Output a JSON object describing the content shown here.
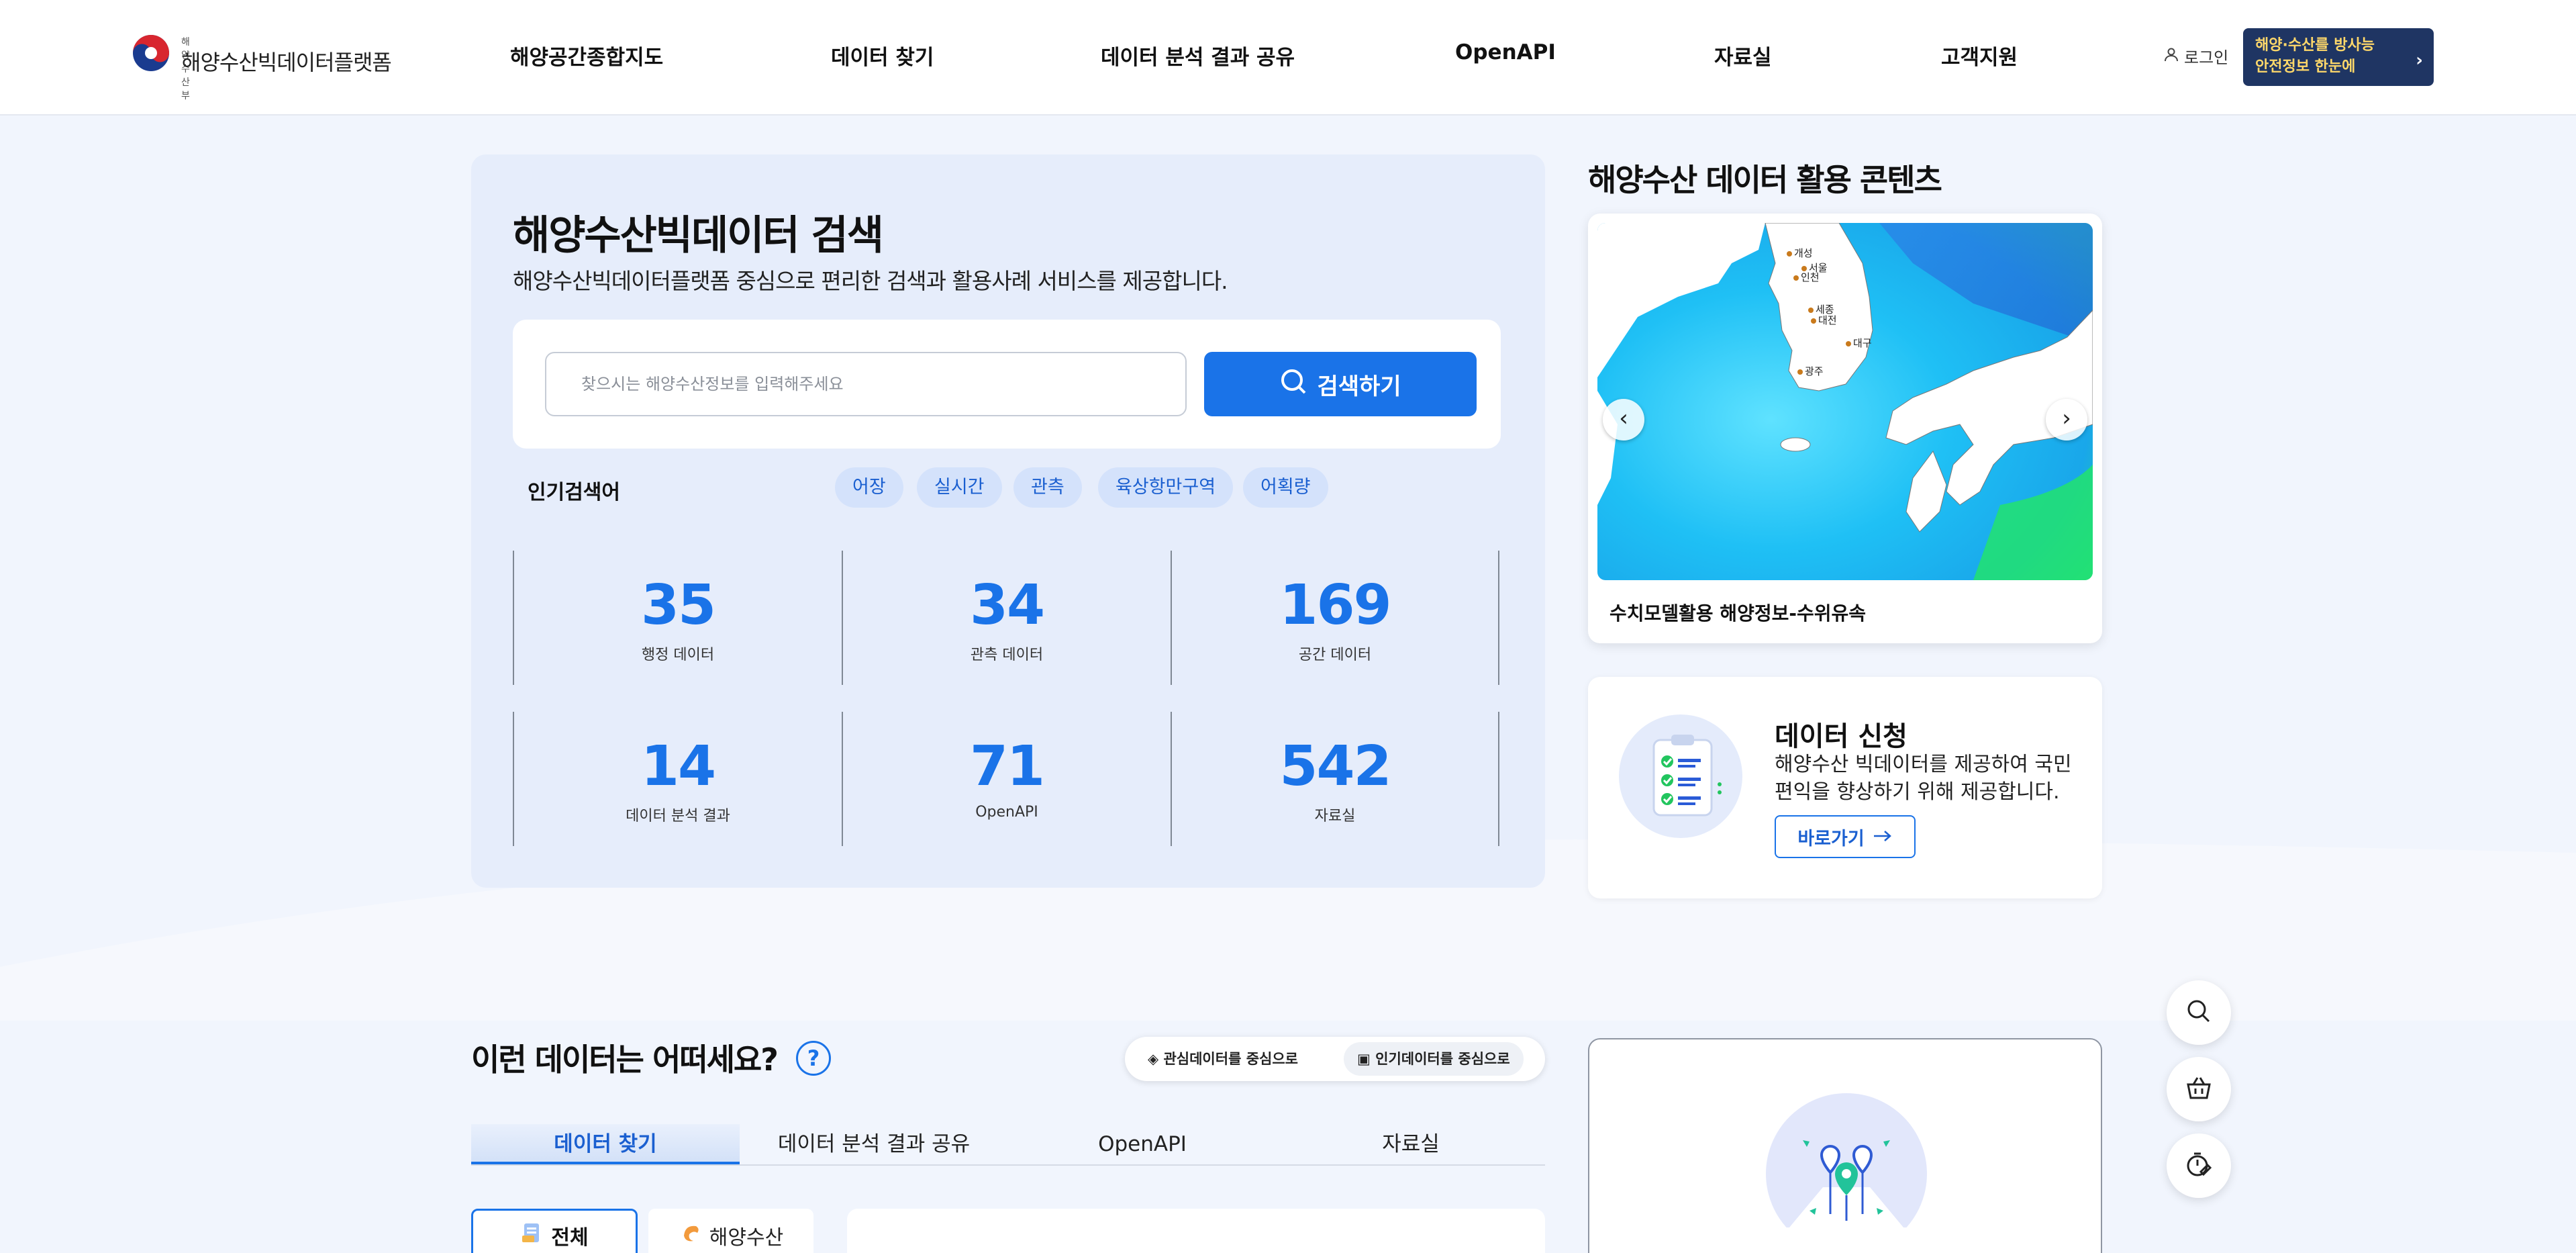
{
  "header": {
    "logo_sub": "해양수산부",
    "logo_text": "해양수산빅데이터플랫폼",
    "nav": [
      "해양공간종합지도",
      "데이터 찾기",
      "데이터 분석 결과 공유",
      "OpenAPI",
      "자료실",
      "고객지원"
    ],
    "login_label": "로그인",
    "banner_line1": "해양·수산를 방사능",
    "banner_line2": "안전정보 한눈에"
  },
  "search": {
    "title": "해양수산빅데이터 검색",
    "description": "해양수산빅데이터플랫폼 중심으로 편리한 검색과 활용사례 서비스를 제공합니다.",
    "placeholder": "찾으시는 해양수산정보를 입력해주세요",
    "button_label": "검색하기",
    "popular_label": "인기검색어",
    "popular_keywords": [
      "어장",
      "실시간",
      "관측",
      "육상항만구역",
      "어획량"
    ]
  },
  "stats": [
    {
      "value": "35",
      "label": "행정 데이터"
    },
    {
      "value": "34",
      "label": "관측 데이터"
    },
    {
      "value": "169",
      "label": "공간 데이터"
    },
    {
      "value": "14",
      "label": "데이터 분석 결과"
    },
    {
      "value": "71",
      "label": "OpenAPI"
    },
    {
      "value": "542",
      "label": "자료실"
    }
  ],
  "contents": {
    "title": "해양수산 데이터 활용 콘텐츠",
    "map_cities": [
      "개성",
      "서울",
      "인천",
      "세종",
      "대전",
      "대구",
      "광주"
    ],
    "caption": "수치모델활용 해양정보-수위유속",
    "prev_label": "‹",
    "next_label": "›"
  },
  "apply": {
    "title": "데이터 신청",
    "description": "해양수산 빅데이터를 제공하여 국민편익을 향상하기 위해 제공합니다.",
    "button_label": "바로가기"
  },
  "recommend": {
    "title": "이런 데이터는 어떠세요?",
    "help_label": "?",
    "toggle": [
      "관심데이터를 중심으로",
      "인기데이터를 중심으로"
    ],
    "tabs": [
      "데이터 찾기",
      "데이터 분석 결과 공유",
      "OpenAPI",
      "자료실"
    ],
    "subtabs": [
      "전체",
      "해양수산"
    ]
  },
  "colors": {
    "accent": "#1a73e8",
    "background": "#f1f5fd",
    "banner": "#1f3563"
  }
}
